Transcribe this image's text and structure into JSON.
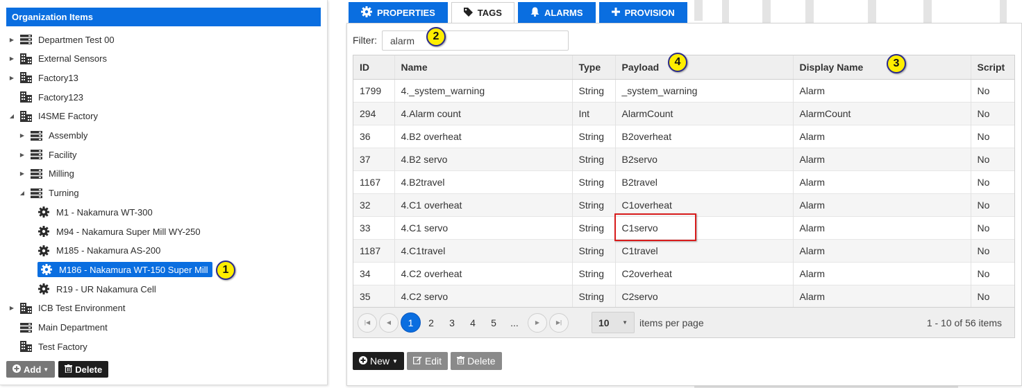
{
  "left_panel": {
    "header": "Organization Items",
    "tree": [
      {
        "label": "Departmen Test 00",
        "level": 0,
        "caret": "collapsed",
        "icon": "server-icon"
      },
      {
        "label": "External Sensors",
        "level": 0,
        "caret": "collapsed",
        "icon": "building-icon"
      },
      {
        "label": "Factory13",
        "level": 0,
        "caret": "collapsed",
        "icon": "building-icon"
      },
      {
        "label": "Factory123",
        "level": 0,
        "caret": "none",
        "icon": "building-icon"
      },
      {
        "label": "I4SME Factory",
        "level": 0,
        "caret": "expanded",
        "icon": "building-icon"
      },
      {
        "label": "Assembly",
        "level": 1,
        "caret": "collapsed",
        "icon": "server-icon"
      },
      {
        "label": "Facility",
        "level": 1,
        "caret": "collapsed",
        "icon": "server-icon"
      },
      {
        "label": "Milling",
        "level": 1,
        "caret": "collapsed",
        "icon": "server-icon"
      },
      {
        "label": "Turning",
        "level": 1,
        "caret": "expanded",
        "icon": "server-icon"
      },
      {
        "label": "M1 - Nakamura WT-300",
        "level": 2,
        "caret": "none",
        "icon": "gear-icon"
      },
      {
        "label": "M94 - Nakamura Super Mill WY-250",
        "level": 2,
        "caret": "none",
        "icon": "gear-icon"
      },
      {
        "label": "M185 - Nakamura AS-200",
        "level": 2,
        "caret": "none",
        "icon": "gear-icon"
      },
      {
        "label": "M186 - Nakamura WT-150 Super Mill",
        "level": 2,
        "caret": "none",
        "icon": "gear-icon",
        "selected": true
      },
      {
        "label": "R19 - UR Nakamura Cell",
        "level": 2,
        "caret": "none",
        "icon": "gear-icon"
      },
      {
        "label": "ICB Test Environment",
        "level": 0,
        "caret": "collapsed",
        "icon": "building-icon"
      },
      {
        "label": "Main Department",
        "level": 0,
        "caret": "none",
        "icon": "server-icon"
      },
      {
        "label": "Test Factory",
        "level": 0,
        "caret": "none",
        "icon": "building-icon"
      }
    ],
    "add_label": "Add",
    "delete_label": "Delete"
  },
  "tabs": [
    {
      "label": "PROPERTIES",
      "icon": "gear-icon",
      "active": false
    },
    {
      "label": "TAGS",
      "icon": "tag-icon",
      "active": true
    },
    {
      "label": "ALARMS",
      "icon": "bell-icon",
      "active": false
    },
    {
      "label": "PROVISION",
      "icon": "plus-icon",
      "active": false
    }
  ],
  "filter": {
    "label": "Filter:",
    "value": "alarm"
  },
  "grid": {
    "columns": [
      "ID",
      "Name",
      "Type",
      "Payload",
      "Display Name",
      "Script"
    ],
    "rows": [
      [
        "1799",
        "4._system_warning",
        "String",
        "_system_warning",
        "Alarm",
        "No"
      ],
      [
        "294",
        "4.Alarm count",
        "Int",
        "AlarmCount",
        "AlarmCount",
        "No"
      ],
      [
        "36",
        "4.B2 overheat",
        "String",
        "B2overheat",
        "Alarm",
        "No"
      ],
      [
        "37",
        "4.B2 servo",
        "String",
        "B2servo",
        "Alarm",
        "No"
      ],
      [
        "1167",
        "4.B2travel",
        "String",
        "B2travel",
        "Alarm",
        "No"
      ],
      [
        "32",
        "4.C1 overheat",
        "String",
        "C1overheat",
        "Alarm",
        "No"
      ],
      [
        "33",
        "4.C1 servo",
        "String",
        "C1servo",
        "Alarm",
        "No"
      ],
      [
        "1187",
        "4.C1travel",
        "String",
        "C1travel",
        "Alarm",
        "No"
      ],
      [
        "34",
        "4.C2 overheat",
        "String",
        "C2overheat",
        "Alarm",
        "No"
      ],
      [
        "35",
        "4.C2 servo",
        "String",
        "C2servo",
        "Alarm",
        "No"
      ]
    ]
  },
  "pager": {
    "pages": [
      "1",
      "2",
      "3",
      "4",
      "5",
      "..."
    ],
    "current": "1",
    "page_size": "10",
    "items_per_page_label": "items per page",
    "summary": "1 - 10 of 56 items"
  },
  "actions": {
    "new_label": "New",
    "edit_label": "Edit",
    "delete_label": "Delete"
  },
  "callouts": [
    "1",
    "2",
    "3",
    "4"
  ],
  "colors": {
    "accent": "#0a6ee0",
    "callout": "#ffee00",
    "highlight": "#d81c1c"
  }
}
